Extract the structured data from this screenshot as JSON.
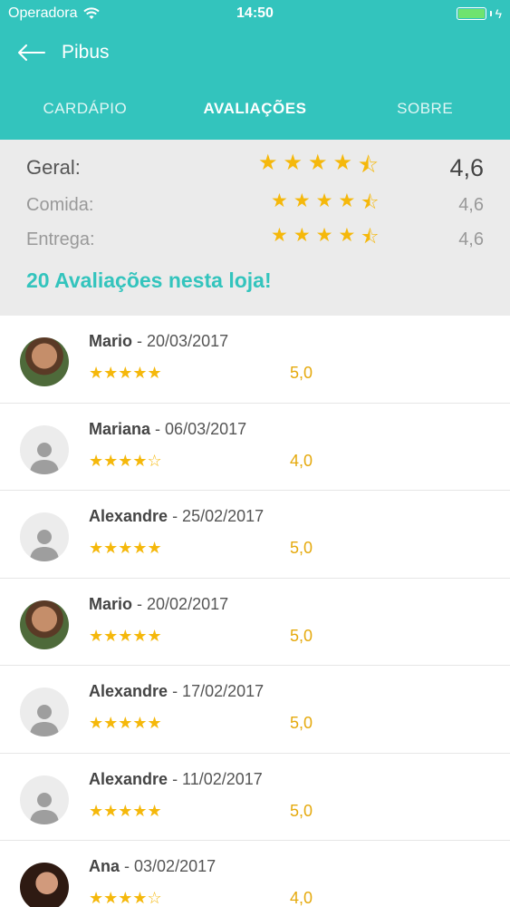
{
  "status": {
    "carrier": "Operadora",
    "time": "14:50"
  },
  "nav": {
    "title": "Pibus"
  },
  "tabs": [
    {
      "label": "CARDÁPIO"
    },
    {
      "label": "AVALIAÇÕES"
    },
    {
      "label": "SOBRE"
    }
  ],
  "summary": {
    "overall": {
      "label": "Geral:",
      "value": "4,6",
      "rating": 4.5
    },
    "food": {
      "label": "Comida:",
      "value": "4,6",
      "rating": 4.5
    },
    "delivery": {
      "label": "Entrega:",
      "value": "4,6",
      "rating": 4.5
    },
    "total_text": "20 Avaliações nesta loja!"
  },
  "reviews": [
    {
      "name": "Mario",
      "date": "- 20/03/2017",
      "stars": "★★★★★",
      "score": "5,0"
    },
    {
      "name": "Mariana",
      "date": "- 06/03/2017",
      "stars": "★★★★☆",
      "score": "4,0"
    },
    {
      "name": "Alexandre",
      "date": "- 25/02/2017",
      "stars": "★★★★★",
      "score": "5,0"
    },
    {
      "name": "Mario",
      "date": "- 20/02/2017",
      "stars": "★★★★★",
      "score": "5,0"
    },
    {
      "name": "Alexandre",
      "date": "- 17/02/2017",
      "stars": "★★★★★",
      "score": "5,0"
    },
    {
      "name": "Alexandre",
      "date": "- 11/02/2017",
      "stars": "★★★★★",
      "score": "5,0"
    },
    {
      "name": "Ana",
      "date": "- 03/02/2017",
      "stars": "★★★★☆",
      "score": "4,0"
    }
  ],
  "colors": {
    "accent": "#33c4bd",
    "star": "#f5b80b",
    "summary_bg": "#ebebeb"
  },
  "icons": [
    "wifi-icon",
    "battery-icon",
    "back-arrow-icon",
    "user-placeholder-icon",
    "star-icon",
    "half-star-icon"
  ]
}
